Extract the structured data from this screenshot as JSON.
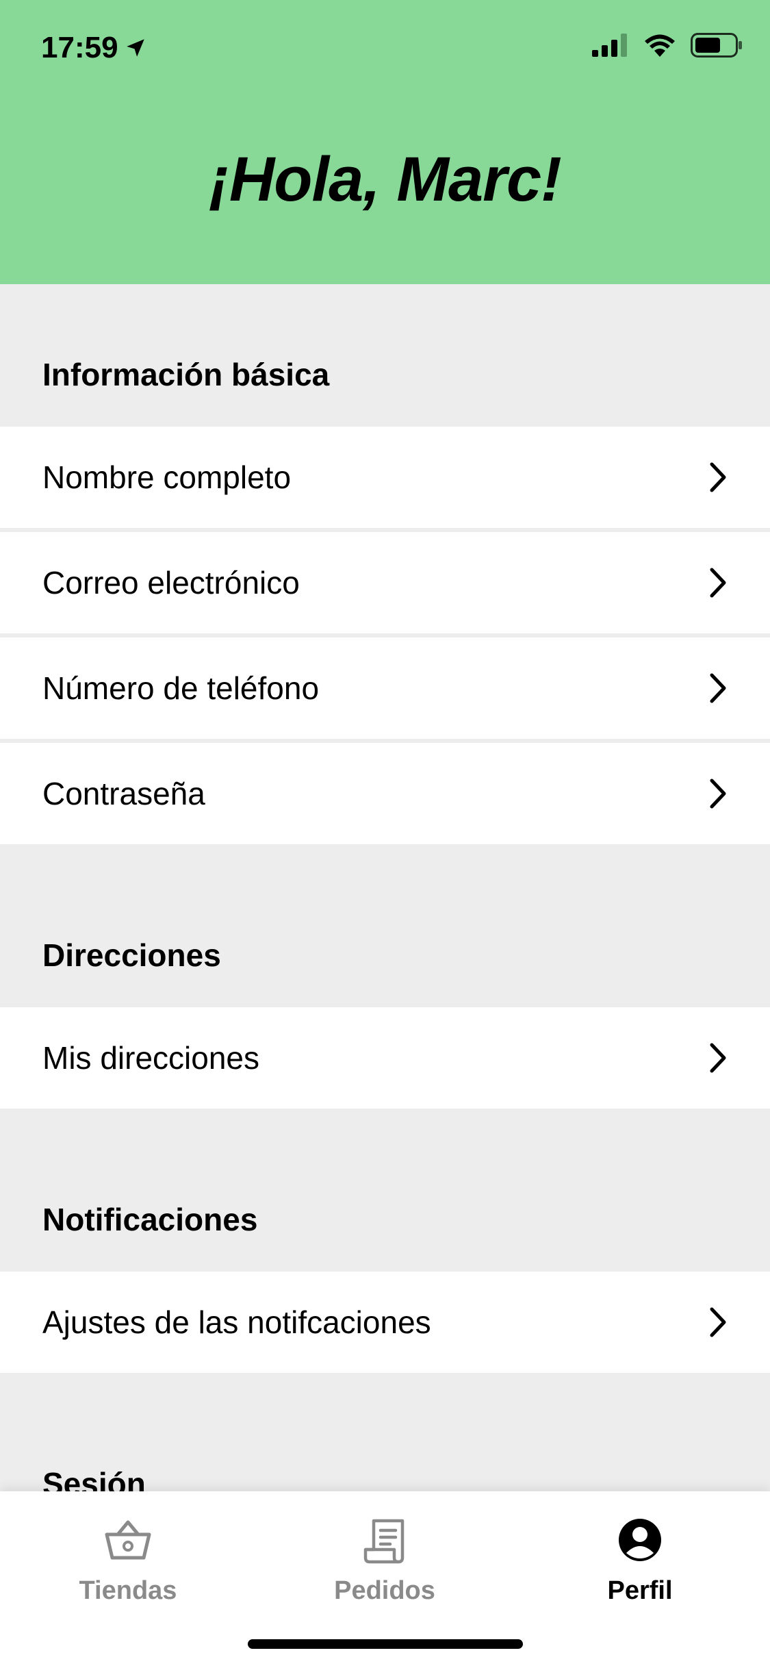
{
  "status_bar": {
    "time": "17:59"
  },
  "header": {
    "greeting": "¡Hola, Marc!"
  },
  "sections": [
    {
      "title": "Información básica",
      "items": [
        "Nombre completo",
        "Correo electrónico",
        "Número de teléfono",
        "Contraseña"
      ]
    },
    {
      "title": "Direcciones",
      "items": [
        "Mis direcciones"
      ]
    },
    {
      "title": "Notificaciones",
      "items": [
        "Ajustes de las notifcaciones"
      ]
    },
    {
      "title": "Sesión",
      "items": []
    }
  ],
  "tabbar": {
    "tabs": [
      {
        "label": "Tiendas",
        "icon": "basket-icon",
        "active": false
      },
      {
        "label": "Pedidos",
        "icon": "receipt-icon",
        "active": false
      },
      {
        "label": "Perfil",
        "icon": "profile-icon",
        "active": true
      }
    ]
  },
  "colors": {
    "header_bg": "#88d998",
    "page_bg": "#ededed",
    "inactive_tab": "#8a8a8a"
  }
}
